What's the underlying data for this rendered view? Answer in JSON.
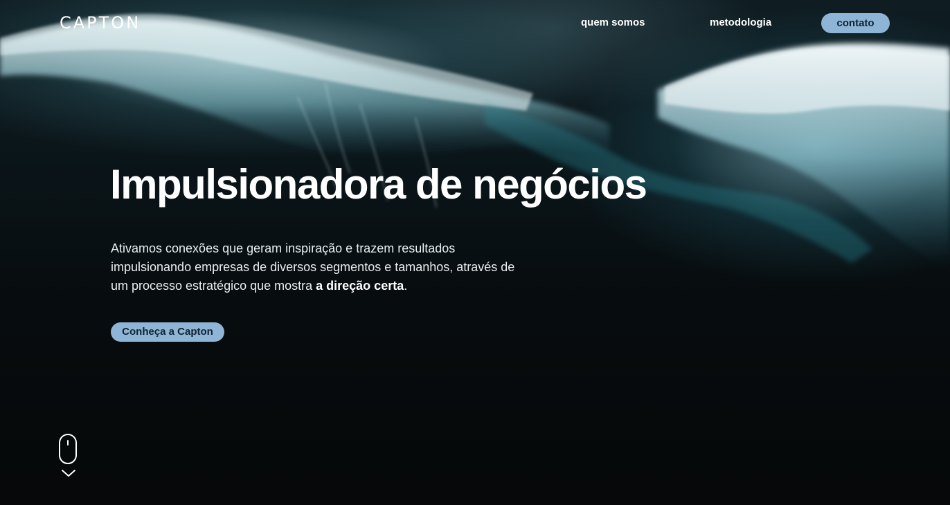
{
  "brand": {
    "logo_text": "CAPTON"
  },
  "nav": {
    "items": [
      {
        "label": "quem somos"
      },
      {
        "label": "metodologia"
      }
    ],
    "contact_label": "contato"
  },
  "hero": {
    "headline": "Impulsionadora de negócios",
    "intro_text": "Ativamos conexões que geram inspiração e trazem resultados impulsionando empresas de diversos segmentos e tamanhos, através de um processo estratégico que mostra ",
    "intro_emphasis": "a direção certa",
    "intro_end": ".",
    "cta_label": "Conheça a Capton"
  },
  "icons": {
    "scroll": "mouse-icon",
    "scroll_arrow": "chevron-down-icon"
  },
  "colors": {
    "accent": "#8fb5d6",
    "accent_text": "#0f2233",
    "background": "#070b0d",
    "foam": "#cfe6ea"
  }
}
